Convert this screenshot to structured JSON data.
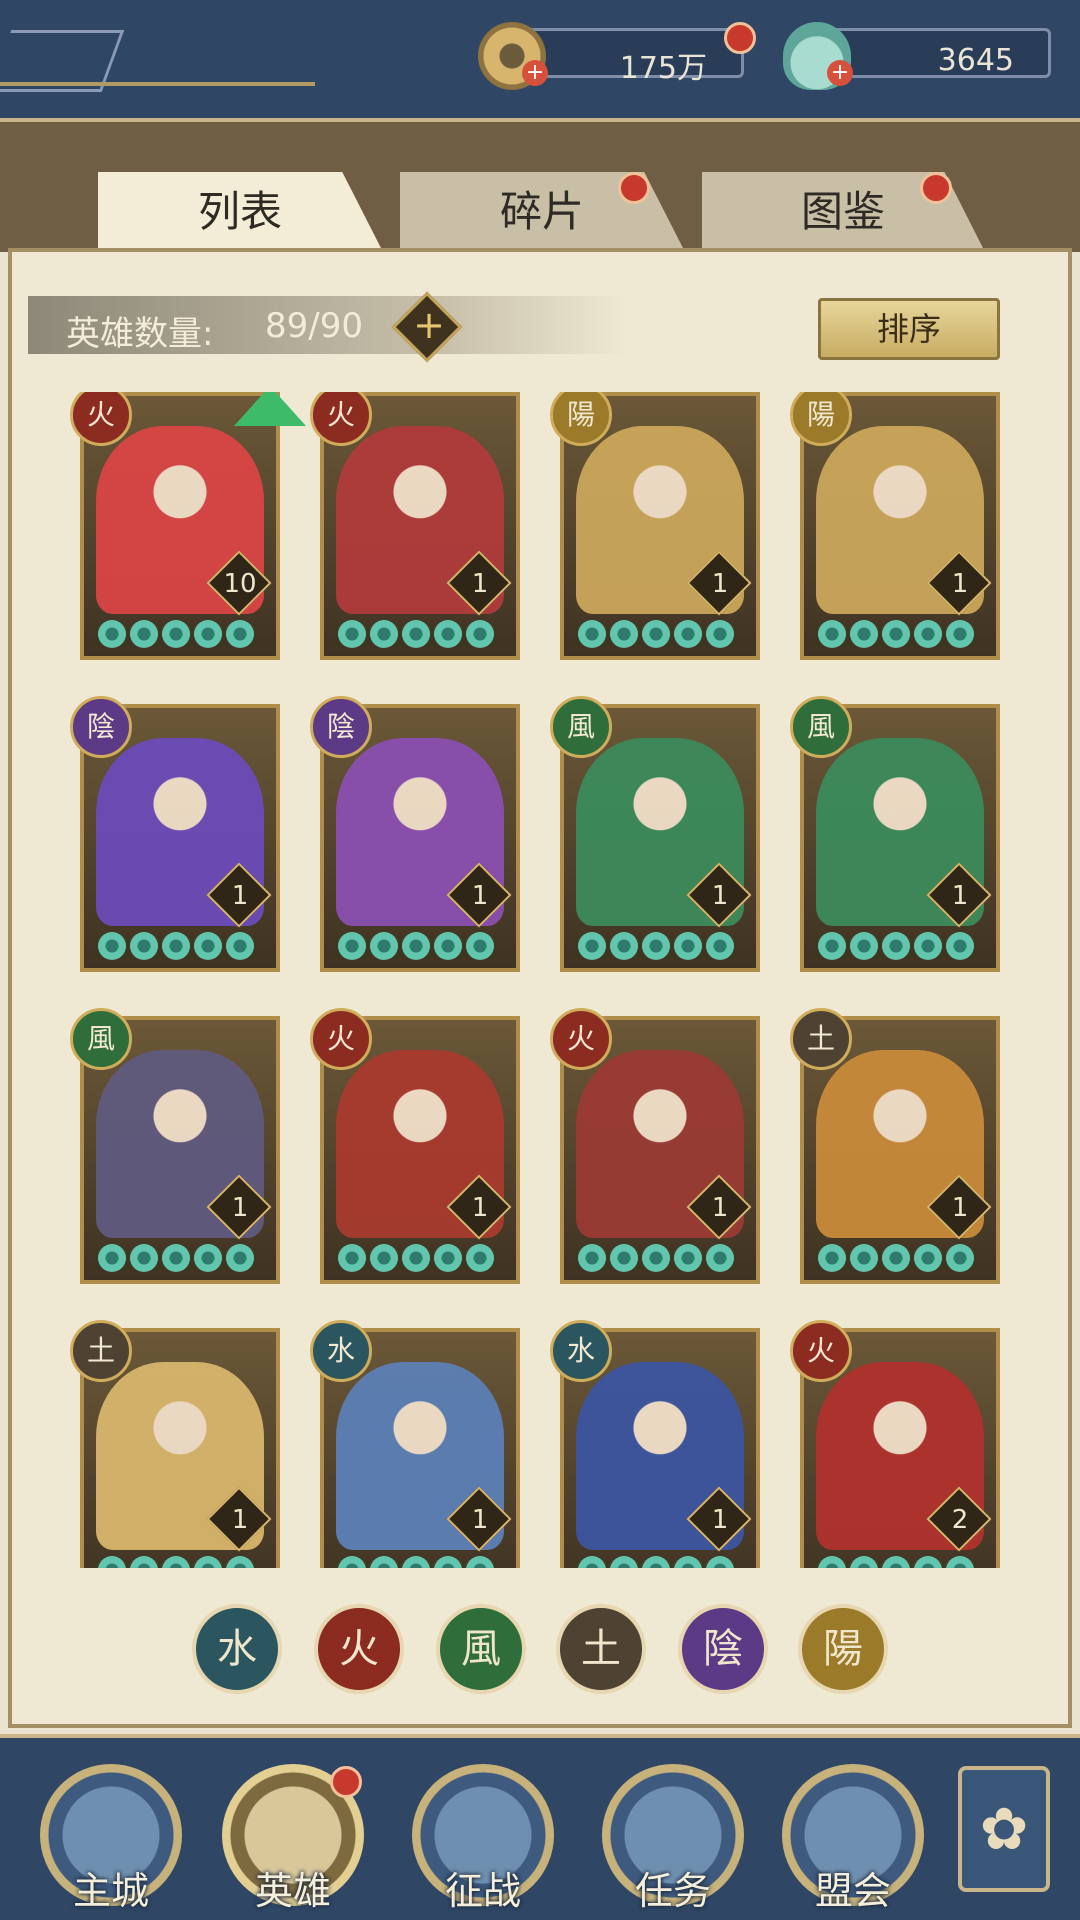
{
  "currency": {
    "coins": "175万",
    "shells": "3645"
  },
  "tabs": [
    {
      "label": "列表"
    },
    {
      "label": "碎片"
    },
    {
      "label": "图鉴"
    }
  ],
  "hero_count": {
    "label": "英雄数量:",
    "value": "89/90"
  },
  "sort_label": "排序",
  "heroes": [
    {
      "element": "火",
      "level": "10",
      "portrait_color": "#d94545"
    },
    {
      "element": "火",
      "level": "1",
      "portrait_color": "#b03b3b"
    },
    {
      "element": "陽",
      "level": "1",
      "portrait_color": "#caa65a"
    },
    {
      "element": "陽",
      "level": "1",
      "portrait_color": "#caa65a"
    },
    {
      "element": "陰",
      "level": "1",
      "portrait_color": "#6a4bb8"
    },
    {
      "element": "陰",
      "level": "1",
      "portrait_color": "#8a4fb0"
    },
    {
      "element": "風",
      "level": "1",
      "portrait_color": "#3b8a5a"
    },
    {
      "element": "風",
      "level": "1",
      "portrait_color": "#3b8a5a"
    },
    {
      "element": "風",
      "level": "1",
      "portrait_color": "#5f5a7e"
    },
    {
      "element": "火",
      "level": "1",
      "portrait_color": "#a83a2e"
    },
    {
      "element": "火",
      "level": "1",
      "portrait_color": "#9a3a34"
    },
    {
      "element": "土",
      "level": "1",
      "portrait_color": "#c88a3a"
    },
    {
      "element": "土",
      "level": "1",
      "portrait_color": "#d7b66c"
    },
    {
      "element": "水",
      "level": "1",
      "portrait_color": "#5b7fb5"
    },
    {
      "element": "水",
      "level": "1",
      "portrait_color": "#3c55a0"
    },
    {
      "element": "火",
      "level": "2",
      "portrait_color": "#b0312d"
    }
  ],
  "filters": [
    "水",
    "火",
    "風",
    "土",
    "陰",
    "陽"
  ],
  "nav": [
    {
      "label": "主城"
    },
    {
      "label": "英雄"
    },
    {
      "label": "征战"
    },
    {
      "label": "任务"
    },
    {
      "label": "盟会"
    }
  ],
  "colors": {
    "fire": "#8c2b20",
    "wind": "#2f6d3a",
    "earth": "#4e4333",
    "water": "#2b5660",
    "yin": "#5c3a86",
    "yang": "#9b7a2a"
  }
}
